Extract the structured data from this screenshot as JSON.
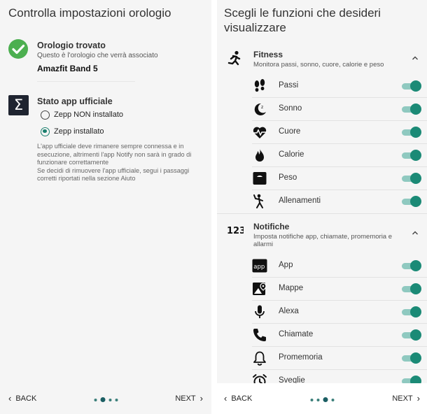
{
  "left": {
    "title": "Controlla impostazioni orologio",
    "found_title": "Orologio trovato",
    "found_subtitle": "Questo è l'orologio che verrà associato",
    "watch_name": "Amazfit Band 5",
    "app_title": "Stato app ufficiale",
    "radio_options": [
      {
        "label": "Zepp NON installato",
        "selected": false
      },
      {
        "label": "Zepp installato",
        "selected": true
      }
    ],
    "info_1": "L'app ufficiale deve rimanere sempre connessa e in esecuzione, altrimenti l'app Notify non sarà in grado di funzionare correttamente",
    "info_2": "Se decidi di rimuovere l'app ufficiale, segui i passaggi corretti riportati nella sezione Aiuto",
    "nav": {
      "back": "BACK",
      "next": "NEXT",
      "active_page": 2,
      "total_pages": 4
    }
  },
  "right": {
    "title": "Scegli le funzioni che desideri visualizzare",
    "fitness": {
      "title": "Fitness",
      "subtitle": "Monitora passi, sonno, cuore, calorie e peso",
      "items": [
        {
          "label": "Passi",
          "icon": "footprints-icon",
          "enabled": true
        },
        {
          "label": "Sonno",
          "icon": "moon-icon",
          "enabled": true
        },
        {
          "label": "Cuore",
          "icon": "heart-icon",
          "enabled": true
        },
        {
          "label": "Calorie",
          "icon": "fire-icon",
          "enabled": true
        },
        {
          "label": "Peso",
          "icon": "scale-icon",
          "enabled": true
        },
        {
          "label": "Allenamenti",
          "icon": "workout-icon",
          "enabled": true
        }
      ]
    },
    "notifiche": {
      "title": "Notifiche",
      "subtitle": "Imposta notifiche app, chiamate, promemoria e allarmi",
      "items": [
        {
          "label": "App",
          "icon": "app-icon",
          "enabled": true
        },
        {
          "label": "Mappe",
          "icon": "map-icon",
          "enabled": true
        },
        {
          "label": "Alexa",
          "icon": "microphone-icon",
          "enabled": true
        },
        {
          "label": "Chiamate",
          "icon": "phone-icon",
          "enabled": true
        },
        {
          "label": "Promemoria",
          "icon": "bell-icon",
          "enabled": true
        },
        {
          "label": "Sveglie",
          "icon": "alarm-clock-icon",
          "enabled": true
        }
      ]
    },
    "nav": {
      "back": "BACK",
      "next": "NEXT",
      "active_page": 3,
      "total_pages": 4
    }
  },
  "colors": {
    "accent": "#1b8a76",
    "check": "#4caf50",
    "background": "#f5f5f5"
  }
}
